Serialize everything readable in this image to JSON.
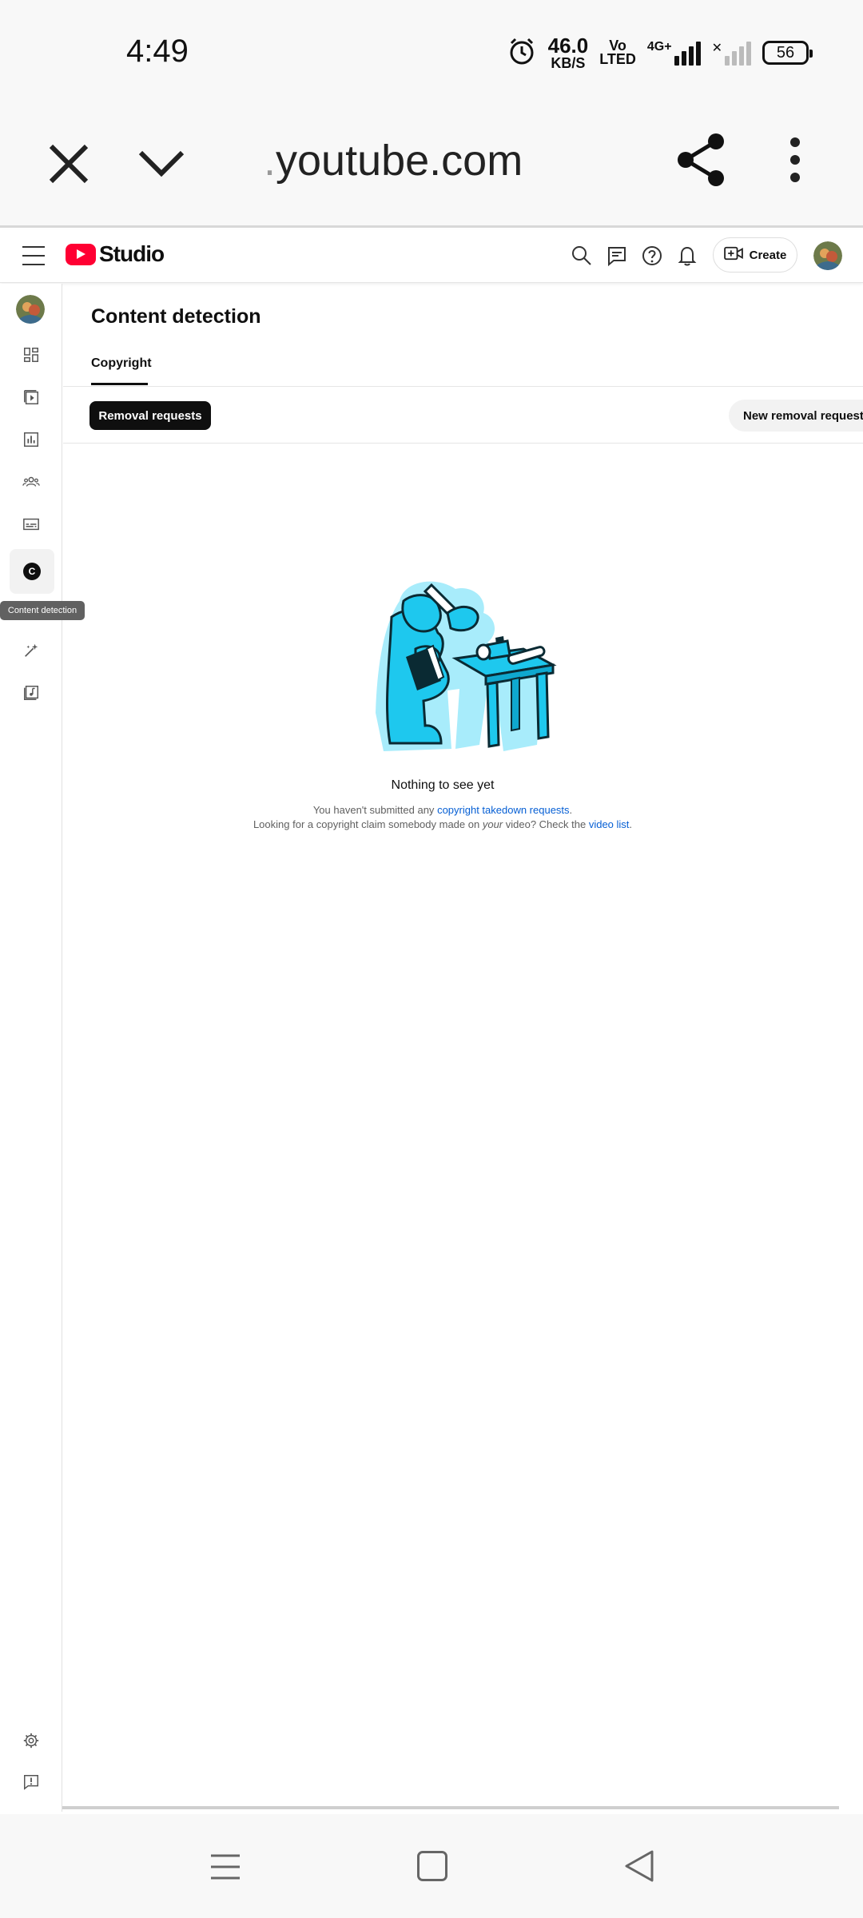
{
  "status_bar": {
    "time": "4:49",
    "net_speed_value": "46.0",
    "net_speed_unit": "KB/S",
    "volte_top": "Vo",
    "volte_bottom": "LTED",
    "network": "4G+",
    "battery": "56"
  },
  "browser": {
    "url_prefix": ".",
    "url": "youtube.com",
    "icons": [
      "close-icon",
      "chevron-down-icon",
      "share-icon",
      "more-vert-icon"
    ]
  },
  "header": {
    "logo_text": "Studio",
    "create_label": "Create",
    "icons": [
      "menu-icon",
      "search-icon",
      "feedback-icon",
      "help-icon",
      "notifications-icon",
      "create-video-icon"
    ]
  },
  "sidebar": {
    "items": [
      "dashboard-icon",
      "content-icon",
      "analytics-icon",
      "community-icon",
      "subtitles-icon",
      "content-detection-icon",
      "customization-icon",
      "audio-library-icon"
    ],
    "active_badge": "C",
    "tooltip": "Content detection",
    "bottom_items": [
      "settings-icon",
      "send-feedback-icon"
    ]
  },
  "main": {
    "title": "Content detection",
    "tab": "Copyright",
    "chip_active": "Removal requests",
    "chip_new": "New removal request",
    "empty_title": "Nothing to see yet",
    "empty_line1_prefix": "You haven't submitted any ",
    "empty_line1_link": "copyright takedown requests",
    "empty_line1_suffix": ".",
    "empty_line2_prefix": "Looking for a copyright claim somebody made on ",
    "empty_line2_em": "your",
    "empty_line2_mid": " video? Check the ",
    "empty_line2_link": "video list",
    "empty_line2_suffix": "."
  },
  "colors": {
    "brand_red": "#ff0033",
    "link": "#065fd4",
    "illustration_cyan": "#2fd3f5"
  }
}
